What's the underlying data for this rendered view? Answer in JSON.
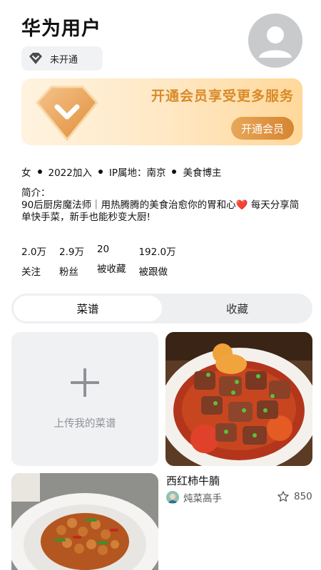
{
  "profile": {
    "username": "华为用户",
    "vip_status": "未开通"
  },
  "banner": {
    "title": "开通会员享受更多服务",
    "button": "开通会员"
  },
  "meta": {
    "gender": "女",
    "joined": "2022加入",
    "ip": "IP属地：南京",
    "tag": "美食博主"
  },
  "bio": {
    "label": "简介：",
    "text_before_heart": "90后厨房魔法师｜用热腾腾的美食治愈你的胃和心",
    "heart": "❤️",
    "text_after_heart": " 每天分享简单快手菜，新手也能秒变大厨!"
  },
  "stats": [
    {
      "num": "2.0万",
      "label": "关注"
    },
    {
      "num": "2.9万",
      "label": "粉丝"
    },
    {
      "num": "20",
      "label": "被收藏"
    },
    {
      "num": "192.0万",
      "label": "被跟做"
    }
  ],
  "tabs": {
    "active": "菜谱",
    "inactive": "收藏"
  },
  "upload": {
    "label": "上传我的菜谱"
  },
  "recipe": {
    "title": "西红柿牛腩",
    "author": "炖菜高手",
    "likes": "850"
  },
  "colors": {
    "accent": "#d98a2a",
    "heart": "#e0202b"
  }
}
